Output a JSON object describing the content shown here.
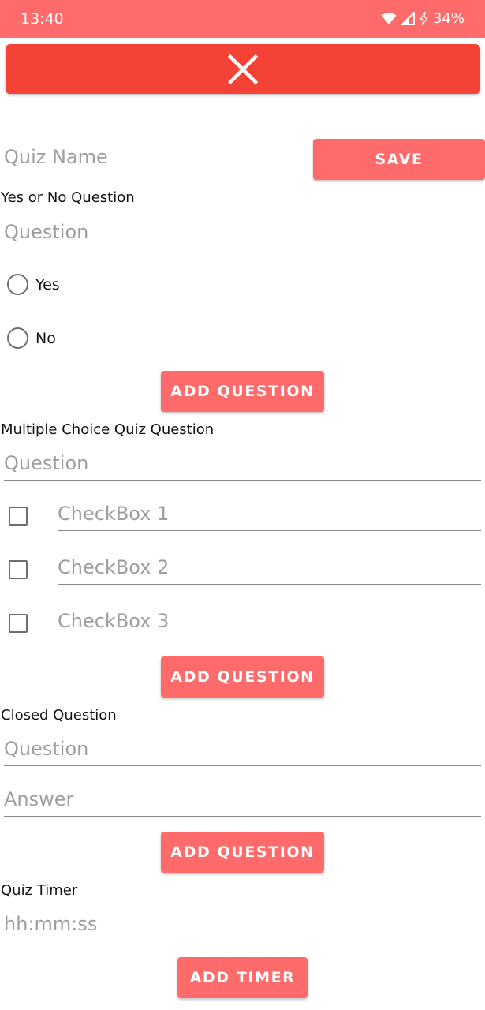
{
  "status_bar": {
    "time": "13:40",
    "battery": "34%"
  },
  "quiz_name": {
    "placeholder": "Quiz Name",
    "save_label": "SAVE"
  },
  "yes_no": {
    "title": "Yes or No Question",
    "question_placeholder": "Question",
    "options": [
      "Yes",
      "No"
    ],
    "add_label": "ADD QUESTION"
  },
  "multiple_choice": {
    "title": "Multiple Choice Quiz Question",
    "question_placeholder": "Question",
    "checkboxes": [
      "CheckBox 1",
      "CheckBox 2",
      "CheckBox 3"
    ],
    "add_label": "ADD QUESTION"
  },
  "closed": {
    "title": "Closed Question",
    "question_placeholder": "Question",
    "answer_placeholder": "Answer",
    "add_label": "ADD QUESTION"
  },
  "timer": {
    "title": "Quiz Timer",
    "placeholder": "hh:mm:ss",
    "add_label": "ADD TIMER"
  }
}
